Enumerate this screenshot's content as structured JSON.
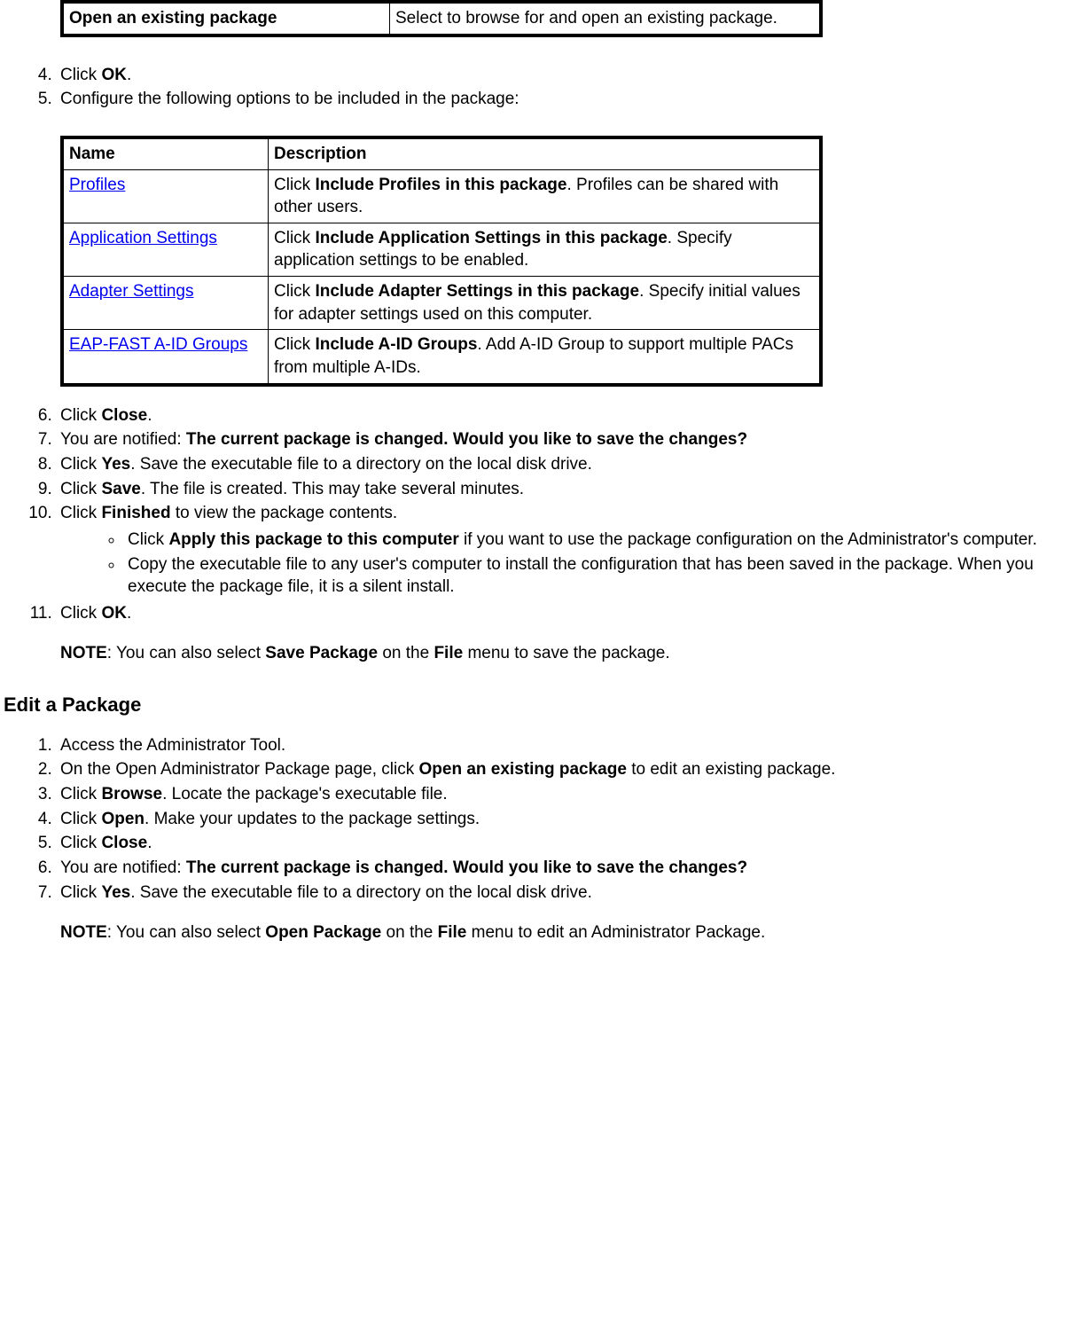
{
  "topTable": {
    "col1": "Open an existing package",
    "col2": "Select to browse for and open an existing package."
  },
  "step4": {
    "pre": "Click ",
    "bold": "OK",
    "post": "."
  },
  "step5": "Configure the following options to be included in the package:",
  "optionsHeader": {
    "name": "Name",
    "desc": "Description"
  },
  "optionRows": {
    "r1": {
      "link": "Profiles",
      "pre": "Click ",
      "bold": "Include Profiles in this package",
      "post": ". Profiles can be shared with other users."
    },
    "r2": {
      "link": "Application Settings",
      "pre": "Click ",
      "bold": "Include Application Settings in this package",
      "post": ". Specify application settings to be enabled."
    },
    "r3": {
      "link": "Adapter Settings",
      "pre": "Click ",
      "bold": "Include Adapter Settings in this package",
      "post": ". Specify initial values for adapter settings used on this computer."
    },
    "r4": {
      "link": "EAP-FAST A-ID Groups",
      "pre": "Click ",
      "bold": "Include A-ID Groups",
      "post": ". Add A-ID Group to support multiple PACs from multiple A-IDs."
    }
  },
  "step6": {
    "pre": "Click ",
    "bold": "Close",
    "post": "."
  },
  "step7": {
    "pre": "You are notified: ",
    "bold": "The current package is changed. Would you like to save the changes?"
  },
  "step8": {
    "pre": "Click ",
    "bold": "Yes",
    "post": ". Save the executable file to a directory on the local disk drive."
  },
  "step9": {
    "pre": "Click ",
    "bold": "Save",
    "post": ". The file is created. This may take several minutes."
  },
  "step10": {
    "pre": "Click ",
    "bold": "Finished",
    "post": " to view the package contents."
  },
  "step10a": {
    "pre": "Click ",
    "bold": "Apply this package to this computer",
    "post": " if you want to use the package configuration on the Administrator's computer."
  },
  "step10b": "Copy the executable file to any user's computer to install the configuration that has been saved in the package. When you execute the package file, it is a silent install.",
  "step11": {
    "pre": "Click ",
    "bold": "OK",
    "post": "."
  },
  "note1": {
    "label": "NOTE",
    "p1": ": You can also select ",
    "b1": "Save Package",
    "p2": " on the ",
    "b2": "File",
    "p3": " menu to save the package."
  },
  "editHeading": "Edit a Package",
  "e1": "Access the Administrator Tool.",
  "e2": {
    "pre": "On the Open Administrator Package page, click ",
    "bold": "Open an existing package",
    "post": " to edit an existing package."
  },
  "e3": {
    "pre": "Click ",
    "bold": "Browse",
    "post": ". Locate the package's executable file."
  },
  "e4": {
    "pre": "Click ",
    "bold": "Open",
    "post": ". Make your updates to the package settings."
  },
  "e5": {
    "pre": "Click ",
    "bold": "Close",
    "post": "."
  },
  "e6": {
    "pre": "You are notified: ",
    "bold": "The current package is changed. Would you like to save the changes?"
  },
  "e7": {
    "pre": "Click ",
    "bold": "Yes",
    "post": ". Save the executable file to a directory on the local disk drive."
  },
  "note2": {
    "label": "NOTE",
    "p1": ": You can also select ",
    "b1": "Open Package",
    "p2": " on the ",
    "b2": "File",
    "p3": " menu to edit an Administrator Package."
  }
}
